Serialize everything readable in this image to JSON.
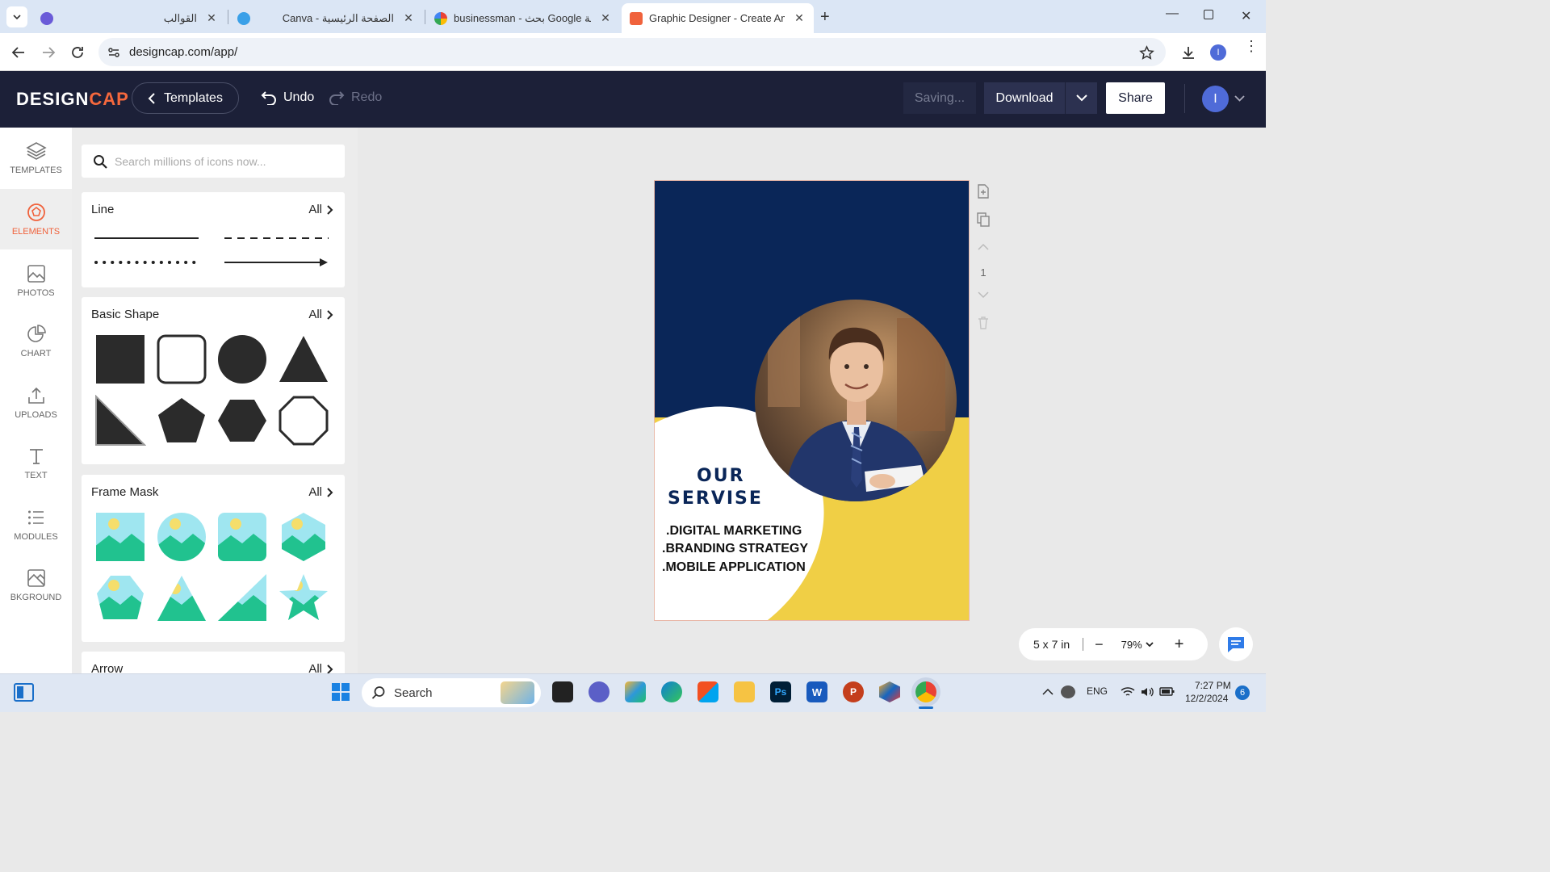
{
  "browser": {
    "tabs": [
      {
        "title": "القوالب",
        "favicon": "canva-icon",
        "active": false
      },
      {
        "title": "Canva - الصفحة الرئيسية",
        "favicon": "canva-icon",
        "active": false
      },
      {
        "title": "businessman - بحث Google عمال واضحة",
        "favicon": "google-icon",
        "active": false
      },
      {
        "title": "Graphic Designer - Create Amazing",
        "favicon": "designcap-icon",
        "active": true
      }
    ],
    "url": "designcap.com/app/",
    "profile_initial": "I"
  },
  "app": {
    "logo_main": "DESIGN",
    "logo_accent": "CAP",
    "templates_label": "Templates",
    "undo_label": "Undo",
    "redo_label": "Redo",
    "saving_label": "Saving...",
    "download_label": "Download",
    "share_label": "Share",
    "avatar_initial": "I",
    "accent_color": "#f0623c",
    "header_color": "#1c2038"
  },
  "rail": {
    "items": [
      {
        "label": "TEMPLATES",
        "icon": "layers-icon"
      },
      {
        "label": "ELEMENTS",
        "icon": "elements-icon"
      },
      {
        "label": "PHOTOS",
        "icon": "image-icon"
      },
      {
        "label": "CHART",
        "icon": "pie-chart-icon"
      },
      {
        "label": "UPLOADS",
        "icon": "upload-icon"
      },
      {
        "label": "TEXT",
        "icon": "text-icon"
      },
      {
        "label": "MODULES",
        "icon": "list-icon"
      },
      {
        "label": "BKGROUND",
        "icon": "background-icon"
      }
    ],
    "selected": "ELEMENTS"
  },
  "panel": {
    "search_placeholder": "Search millions of icons now...",
    "all_label": "All",
    "sections": {
      "line": "Line",
      "basic_shape": "Basic Shape",
      "frame_mask": "Frame Mask",
      "arrow": "Arrow"
    }
  },
  "design": {
    "heading_line1": "OUR",
    "heading_line2": "SERVISE",
    "service1": ".DIGITAL MARKETING",
    "service2": ".BRANDING STRATEGY",
    "service3": ".MOBILE APPLICATION",
    "navy": "#0a2658",
    "yellow": "#f0cf45"
  },
  "page_tools": {
    "page_number": "1"
  },
  "zoom": {
    "size_label": "5 x 7 in",
    "zoom_label": "79%"
  },
  "taskbar": {
    "search_label": "Search",
    "language": "ENG",
    "time": "7:27 PM",
    "date": "12/2/2024",
    "notifications": "6"
  }
}
